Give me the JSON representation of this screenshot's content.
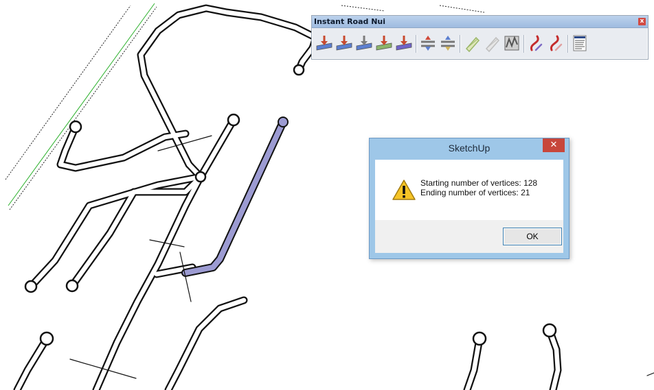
{
  "colors": {
    "road_line": "#111111",
    "selected_road": "#9c9bd2",
    "guide_green": "#2ab02a",
    "toolbar_bg": "#e9ecf1",
    "dialog_frame": "#9ec7e8",
    "close_red": "#c7463b"
  },
  "toolbar": {
    "title": "Instant Road Nui",
    "close_glyph": "x",
    "buttons": [
      {
        "icon": "road-up-icon",
        "c1": "#c84a2f",
        "c2": "#5c7fd0"
      },
      {
        "icon": "road-down-icon",
        "c1": "#c84a2f",
        "c2": "#5c7fd0"
      },
      {
        "icon": "road-flat-icon",
        "c1": "#7d7d7d",
        "c2": "#5c7fd0"
      },
      {
        "icon": "road-edge-icon",
        "c1": "#c84a2f",
        "c2": "#8bb56a"
      },
      {
        "icon": "road-curb-icon",
        "c1": "#c84a2f",
        "c2": "#6f63c9"
      },
      {
        "icon": "road-stack-up-icon",
        "c1": "#d04a3a",
        "c2": "#5c7fd0"
      },
      {
        "icon": "road-stack-down-icon",
        "c1": "#5c7fd0",
        "c2": "#d0b35c"
      },
      {
        "icon": "pencil-path-icon",
        "c1": "#9bb76a",
        "c2": "#dfe7b8"
      },
      {
        "icon": "pencil-path-gray-icon",
        "c1": "#bfbfbf",
        "c2": "#e6e6e6"
      },
      {
        "icon": "simplify-vertices-icon",
        "c1": "#555555",
        "c2": "#cfcfcf"
      },
      {
        "icon": "red-path-icon",
        "c1": "#c42c2c",
        "c2": "#7e6bc4"
      },
      {
        "icon": "red-curve-icon",
        "c1": "#c42c2c",
        "c2": "#e0a0a0"
      },
      {
        "icon": "settings-list-icon",
        "c1": "#2d4a8a",
        "c2": "#ffffff"
      }
    ]
  },
  "dialog": {
    "title": "SketchUp",
    "close_glyph": "✕",
    "line1": "Starting number of vertices: 128",
    "line2": "Ending number of vertices: 21",
    "ok_label": "OK"
  }
}
